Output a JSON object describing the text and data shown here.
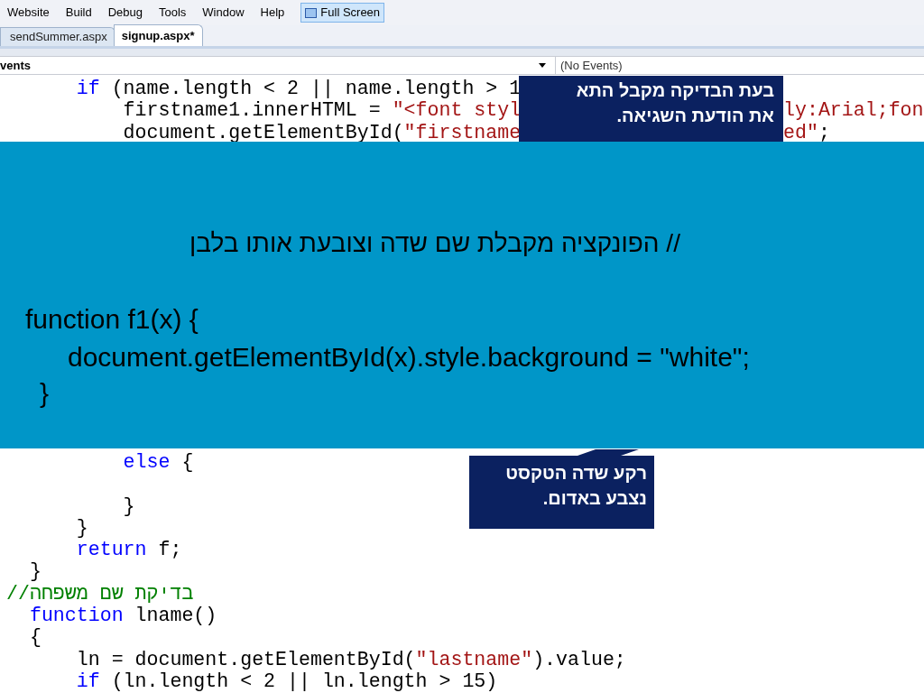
{
  "menu": [
    {
      "label": "Website"
    },
    {
      "label": "Build"
    },
    {
      "label": "Debug"
    },
    {
      "label": "Tools"
    },
    {
      "label": "Window"
    },
    {
      "label": "Help"
    }
  ],
  "full_screen_button": {
    "label": "Full Screen"
  },
  "tabs": [
    {
      "label": "sendSummer.aspx",
      "selected": false
    },
    {
      "label": "signup.aspx*",
      "selected": true
    }
  ],
  "object_dropdown": {
    "value": "vents"
  },
  "events_dropdown": {
    "value": "(No Events)"
  },
  "code_top": [
    {
      "kind": "code",
      "tokens": [
        {
          "kind": "keyword",
          "text": "      if"
        },
        {
          "kind": "plain",
          "text": " (name.length < 2 || name.length > 1"
        }
      ]
    },
    {
      "kind": "code",
      "tokens": [
        {
          "kind": "plain",
          "text": "          firstname1.innerHTML = "
        },
        {
          "kind": "string",
          "text": "\"<font styl"
        }
      ],
      "right_tokens": [
        {
          "kind": "string",
          "text": "ly:Arial;fon"
        }
      ]
    },
    {
      "kind": "code",
      "tokens": [
        {
          "kind": "plain",
          "text": "          document.getElementById("
        },
        {
          "kind": "string",
          "text": "\"firstname"
        }
      ],
      "right_tokens": [
        {
          "kind": "string",
          "text": "ed\""
        },
        {
          "kind": "plain",
          "text": ";"
        }
      ]
    }
  ],
  "callout_top": {
    "lines": [
      "בעת הבדיקה מקבל התא",
      "את הודעת השגיאה."
    ]
  },
  "band": {
    "comment": "// הפונקציה מקבלת שם שדה וצובעת אותו בלבן",
    "code_lines": [
      "function f1(x) {",
      "document.getElementById(x).style.background = \"white\";",
      "}"
    ]
  },
  "code_bottom": [
    {
      "kind": "code",
      "tokens": [
        {
          "kind": "keyword",
          "text": "          else"
        },
        {
          "kind": "plain",
          "text": " {"
        }
      ]
    },
    {
      "kind": "blank"
    },
    {
      "kind": "code",
      "tokens": [
        {
          "kind": "plain",
          "text": "          }"
        }
      ]
    },
    {
      "kind": "code",
      "tokens": [
        {
          "kind": "plain",
          "text": "      }"
        }
      ]
    },
    {
      "kind": "code",
      "tokens": [
        {
          "kind": "keyword",
          "text": "      return"
        },
        {
          "kind": "plain",
          "text": " f;"
        }
      ]
    },
    {
      "kind": "code",
      "tokens": [
        {
          "kind": "plain",
          "text": "  }"
        }
      ]
    },
    {
      "kind": "code",
      "tokens": [
        {
          "kind": "comment",
          "text": "//בדיקת שם משפחה"
        }
      ]
    },
    {
      "kind": "code",
      "tokens": [
        {
          "kind": "keyword",
          "text": "  function"
        },
        {
          "kind": "plain",
          "text": " lname()"
        }
      ]
    },
    {
      "kind": "code",
      "tokens": [
        {
          "kind": "plain",
          "text": "  {"
        }
      ]
    },
    {
      "kind": "code",
      "tokens": [
        {
          "kind": "plain",
          "text": "      ln = document.getElementById("
        },
        {
          "kind": "string",
          "text": "\"lastname\""
        },
        {
          "kind": "plain",
          "text": ").value;"
        }
      ]
    },
    {
      "kind": "code",
      "tokens": [
        {
          "kind": "keyword",
          "text": "      if"
        },
        {
          "kind": "plain",
          "text": " (ln.length < 2 || ln.length > 15)"
        }
      ]
    }
  ],
  "callout_bottom": {
    "lines": [
      "רקע שדה הטקסט",
      "נצבע באדום."
    ]
  }
}
